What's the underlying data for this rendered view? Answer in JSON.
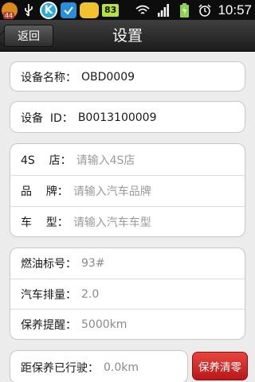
{
  "statusbar": {
    "notification_count": "44",
    "k_icon_letter": "K",
    "battery_level": "83",
    "time": "10:57"
  },
  "header": {
    "back_label": "返回",
    "title": "设置"
  },
  "device": {
    "name_label": "设备名称：",
    "name_value": "OBD0009",
    "id_label": "设备  ID：",
    "id_value": "B0013100009"
  },
  "car_info": {
    "store_label": "4S    店：",
    "store_placeholder": "请输入4S店",
    "brand_label": "品    牌：",
    "brand_placeholder": "请输入汽车品牌",
    "model_label": "车    型：",
    "model_placeholder": "请输入汽车车型"
  },
  "specs": {
    "fuel_label": "燃油标号：",
    "fuel_value": "93#",
    "displacement_label": "汽车排量：",
    "displacement_value": "2.0",
    "reminder_label": "保养提醒：",
    "reminder_value": "5000km"
  },
  "maintenance": {
    "distance_label": "距保养已行驶：",
    "distance_value": "0.0km",
    "clear_label": "保养清零"
  }
}
